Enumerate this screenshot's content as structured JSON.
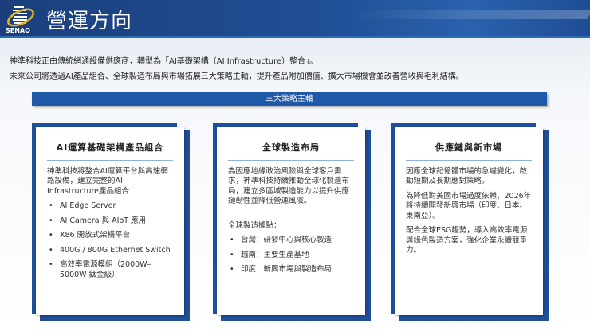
{
  "header": {
    "title": "營運方向",
    "logo_text": "SENAO"
  },
  "intro": [
    "神準科技正由傳統網通設備供應商，轉型為「AI基礎架構（AI Infrastructure）整合」。",
    "未來公司將透過AI產品組合、全球製造布局與市場拓展三大策略主軸，提升產品附加價值、擴大市場機會並改善營收與毛利結構。"
  ],
  "strategy_bar": "三大策略主軸",
  "cards": [
    {
      "title": "AI運算基礎架構產品組合",
      "paragraphs": [
        "神準科技將整合AI運算平台與高速網路設備，建立完整的AI Infrastructure產品組合"
      ],
      "subheading": "",
      "bullets": [
        "AI Edge Server",
        "AI Camera 與 AIoT 應用",
        "X86 開放式架構平台",
        "400G / 800G Ethernet Switch",
        "高效率電源模組（2000W–5000W 鈦金級）"
      ]
    },
    {
      "title": "全球製造布局",
      "paragraphs": [
        "為因應地緣政治風險與全球客戶需求，神準科技持續推動全球化製造布局，建立多區域製造能力以提升供應鏈韌性並降低營運風險。"
      ],
      "subheading": "全球製造據點：",
      "bullets": [
        "台灣：研發中心與核心製造",
        "越南：主要生產基地",
        "印度：新興市場與製造布局"
      ]
    },
    {
      "title": "供應鏈與新市場",
      "paragraphs": [
        "因應全球記憶體市場的急遽變化，啟動短期及長期應對策略。",
        "為降低對美國市場過度依賴，2026年將持續開發新興市場（印度、日本、東南亞）。",
        "配合全球ESG趨勢，導入高效率電源與綠色製造方案，強化企業永續競爭力。"
      ],
      "subheading": "",
      "bullets": []
    }
  ]
}
